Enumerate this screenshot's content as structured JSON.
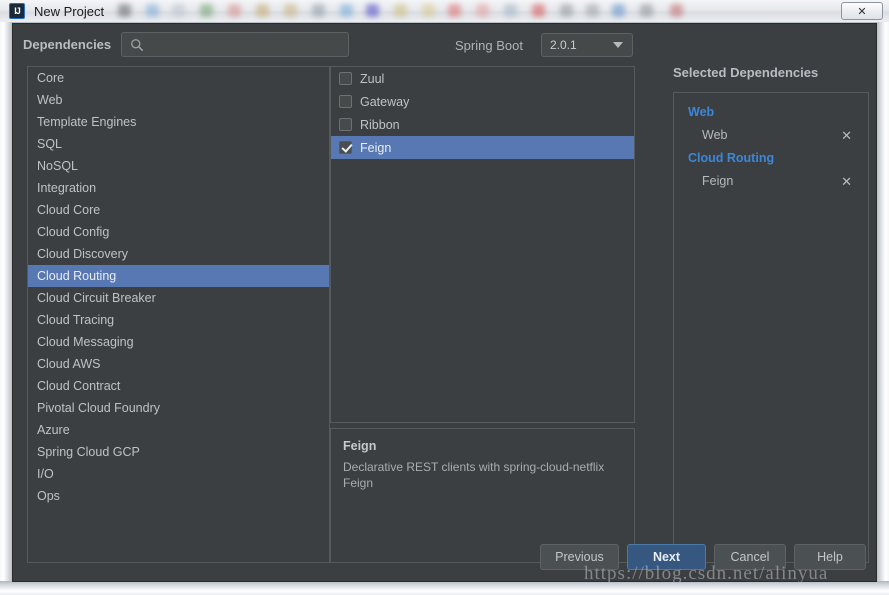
{
  "window": {
    "title": "New Project",
    "app_icon": "intellij-idea-icon",
    "close_label": "✕"
  },
  "toolbar": {
    "dependencies_label": "Dependencies",
    "search_placeholder": "",
    "search_value": "",
    "search_icon": "search-icon",
    "spring_boot_label": "Spring Boot",
    "spring_boot_version": "2.0.1",
    "chevron_icon": "chevron-down-icon"
  },
  "categories": {
    "selected": "Cloud Routing",
    "items": [
      {
        "label": "Core"
      },
      {
        "label": "Web"
      },
      {
        "label": "Template Engines"
      },
      {
        "label": "SQL"
      },
      {
        "label": "NoSQL"
      },
      {
        "label": "Integration"
      },
      {
        "label": "Cloud Core"
      },
      {
        "label": "Cloud Config"
      },
      {
        "label": "Cloud Discovery"
      },
      {
        "label": "Cloud Routing"
      },
      {
        "label": "Cloud Circuit Breaker"
      },
      {
        "label": "Cloud Tracing"
      },
      {
        "label": "Cloud Messaging"
      },
      {
        "label": "Cloud AWS"
      },
      {
        "label": "Cloud Contract"
      },
      {
        "label": "Pivotal Cloud Foundry"
      },
      {
        "label": "Azure"
      },
      {
        "label": "Spring Cloud GCP"
      },
      {
        "label": "I/O"
      },
      {
        "label": "Ops"
      }
    ]
  },
  "dependencies": {
    "items": [
      {
        "label": "Zuul",
        "checked": false,
        "selected": false
      },
      {
        "label": "Gateway",
        "checked": false,
        "selected": false
      },
      {
        "label": "Ribbon",
        "checked": false,
        "selected": false
      },
      {
        "label": "Feign",
        "checked": true,
        "selected": true
      }
    ]
  },
  "description": {
    "title": "Feign",
    "text": "Declarative REST clients with spring-cloud-netflix Feign"
  },
  "selected_dependencies": {
    "title": "Selected Dependencies",
    "remove_icon": "✕",
    "groups": [
      {
        "name": "Web",
        "entries": [
          {
            "label": "Web"
          }
        ]
      },
      {
        "name": "Cloud Routing",
        "entries": [
          {
            "label": "Feign"
          }
        ]
      }
    ]
  },
  "buttons": {
    "previous": "Previous",
    "next": "Next",
    "cancel": "Cancel",
    "help": "Help"
  },
  "watermark": "https://blog.csdn.net/alinyua",
  "colors": {
    "dialog_bg": "#3c3f41",
    "selection_blue": "#5878b4",
    "group_blue": "#3b87d9",
    "primary_button": "#365880",
    "panel_border": "#555a5c",
    "text": "#bfc2c6"
  }
}
